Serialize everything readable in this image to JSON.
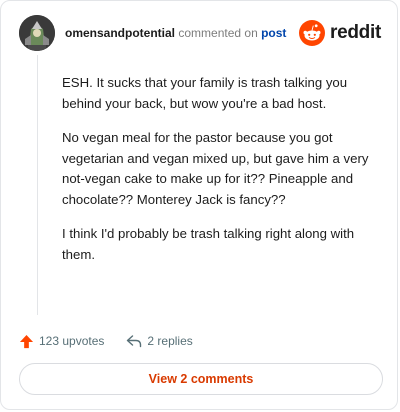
{
  "header": {
    "username": "omensandpotential",
    "commented_on": "commented on",
    "post_link": "post",
    "brand": "reddit",
    "brand_color": "#ff4500"
  },
  "comment": {
    "paragraphs": [
      "ESH. It sucks that your family is trash talking you behind your back, but wow you're a bad host.",
      "No vegan meal for the pastor because you got vegetarian and vegan mixed up, but gave him a very not-vegan cake to make up for it?? Pineapple and chocolate?? Monterey Jack is fancy??",
      "I think I'd probably be trash talking right along with them."
    ]
  },
  "actions": {
    "upvotes": "123 upvotes",
    "replies": "2 replies",
    "upvote_icon": "arrow-up-icon",
    "reply_icon": "reply-arrow-icon"
  },
  "view_button": {
    "label": "View 2 comments",
    "color": "#d93a00"
  }
}
